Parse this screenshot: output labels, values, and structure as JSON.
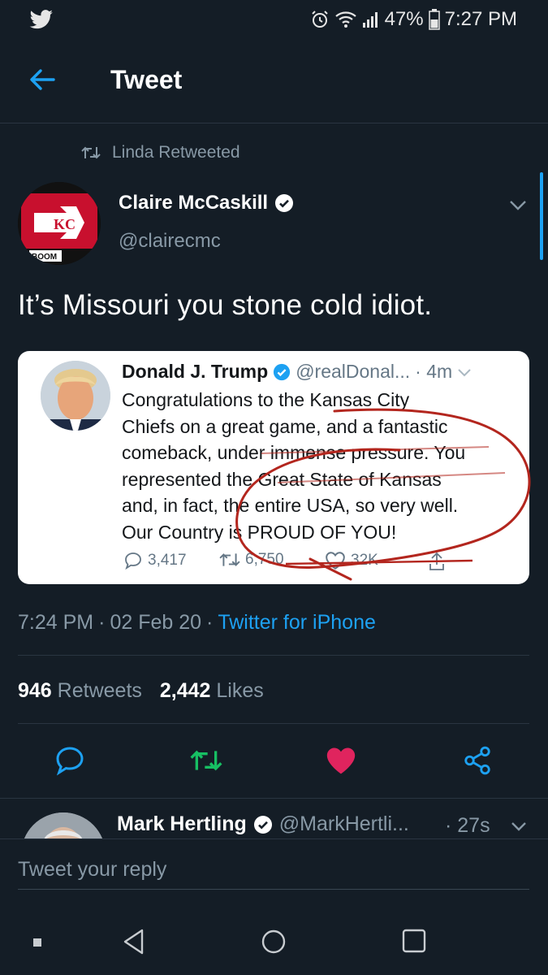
{
  "status_bar": {
    "battery": "47%",
    "time": "7:27 PM",
    "icons": [
      "twitter-bird-icon",
      "alarm-icon",
      "wifi-icon",
      "signal-icon",
      "battery-icon"
    ]
  },
  "header": {
    "title": "Tweet",
    "back_icon": "back-arrow-icon"
  },
  "retweet_context": {
    "text": "Linda Retweeted"
  },
  "tweet": {
    "author_name": "Claire McCaskill",
    "author_handle": "@clairecmc",
    "avatar_badge_text": "BOOM",
    "text": "It’s Missouri you stone cold idiot.",
    "timestamp": "7:24 PM",
    "date": "02 Feb 20",
    "source": "Twitter for iPhone",
    "retweets_count": "946",
    "retweets_label": "Retweets",
    "likes_count": "2,442",
    "likes_label": "Likes"
  },
  "quoted": {
    "author_name": "Donald J. Trump",
    "author_handle": "@realDonal...",
    "time": "· 4m",
    "lines": [
      "Congratulations to the Kansas City",
      "Chiefs on a great game, and a fantastic",
      "comeback, under immense pressure. You",
      "represented the Great State of Kansas",
      "and, in fact, the entire USA, so very well.",
      "Our Country is PROUD OF YOU!"
    ],
    "replies": "3,417",
    "retweets": "6,750",
    "likes": "32K"
  },
  "next_reply": {
    "author_name": "Mark Hertling",
    "author_handle": "@MarkHertli...",
    "time": "· 27s"
  },
  "reply_box": {
    "placeholder": "Tweet your reply"
  },
  "colors": {
    "background": "#141d26",
    "accent": "#1da1f2",
    "retweet_green": "#17bf63",
    "like_red": "#e0245e",
    "muted": "#8899a6",
    "annotation_red": "#b3261e"
  }
}
